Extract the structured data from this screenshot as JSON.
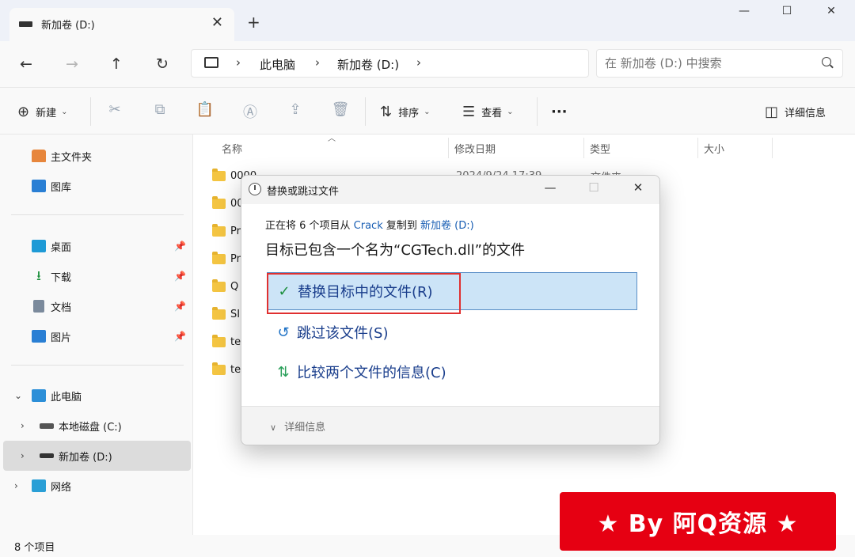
{
  "window": {
    "tab_title": "新加卷 (D:)",
    "tab_close": "✕",
    "new_tab": "+",
    "minimize": "—",
    "maximize": "☐",
    "close": "✕"
  },
  "nav": {
    "back": "←",
    "forward": "→",
    "up": "↑",
    "refresh": "↻",
    "breadcrumbs": [
      "此电脑",
      "新加卷 (D:)"
    ],
    "separator": "›",
    "search_placeholder": "在 新加卷 (D:) 中搜索"
  },
  "toolbar": {
    "new_label": "新建",
    "sort_label": "排序",
    "view_label": "查看",
    "more": "···",
    "details_label": "详细信息",
    "icons": [
      "cut-icon",
      "copy-icon",
      "paste-icon",
      "rename-icon",
      "share-icon",
      "delete-icon"
    ]
  },
  "sidebar": {
    "items": [
      {
        "label": "主文件夹",
        "icon": "home-icon"
      },
      {
        "label": "图库",
        "icon": "gallery-icon"
      },
      {
        "label": "桌面",
        "icon": "desktop-icon"
      },
      {
        "label": "下载",
        "icon": "download-icon"
      },
      {
        "label": "文档",
        "icon": "documents-icon"
      },
      {
        "label": "图片",
        "icon": "pictures-icon"
      },
      {
        "label": "此电脑",
        "icon": "this-pc-icon"
      },
      {
        "label": "本地磁盘 (C:)",
        "icon": "local-disk-icon"
      },
      {
        "label": "新加卷 (D:)",
        "icon": "drive-icon"
      },
      {
        "label": "网络",
        "icon": "network-icon"
      }
    ]
  },
  "content": {
    "columns": [
      "名称",
      "修改日期",
      "类型",
      "大小"
    ],
    "rows": [
      {
        "name": "0000",
        "date": "2024/9/24 17:39",
        "type": "文件夹"
      },
      {
        "name": "00",
        "date": "",
        "type": ""
      },
      {
        "name": "Pr",
        "date": "",
        "type": ""
      },
      {
        "name": "Pr",
        "date": "",
        "type": ""
      },
      {
        "name": "Q",
        "date": "",
        "type": ""
      },
      {
        "name": "SI",
        "date": "",
        "type": ""
      },
      {
        "name": "te",
        "date": "",
        "type": ""
      },
      {
        "name": "te",
        "date": "",
        "type": ""
      }
    ]
  },
  "status": {
    "item_count": "8 个项目"
  },
  "dialog": {
    "title": "替换或跳过文件",
    "info_prefix": "正在将 6 个项目从 ",
    "info_source": "Crack",
    "info_middle": " 复制到 ",
    "info_dest": "新加卷 (D:)",
    "heading": "目标已包含一个名为“CGTech.dll”的文件",
    "options": [
      {
        "label": "替换目标中的文件(R)",
        "icon": "checkmark-icon",
        "glyph": "✓"
      },
      {
        "label": "跳过该文件(S)",
        "icon": "skip-icon",
        "glyph": "↺"
      },
      {
        "label": "比较两个文件的信息(C)",
        "icon": "compare-icon",
        "glyph": "⇅"
      }
    ],
    "more_details": "详细信息",
    "minimize": "—",
    "maximize": "☐",
    "close": "✕"
  },
  "banner": {
    "text": "★ By 阿Q资源 ★"
  },
  "colors": {
    "accent": "#1a5fb4",
    "highlight": "#cce4f7",
    "red_box": "#e03030",
    "banner": "#e60012"
  }
}
